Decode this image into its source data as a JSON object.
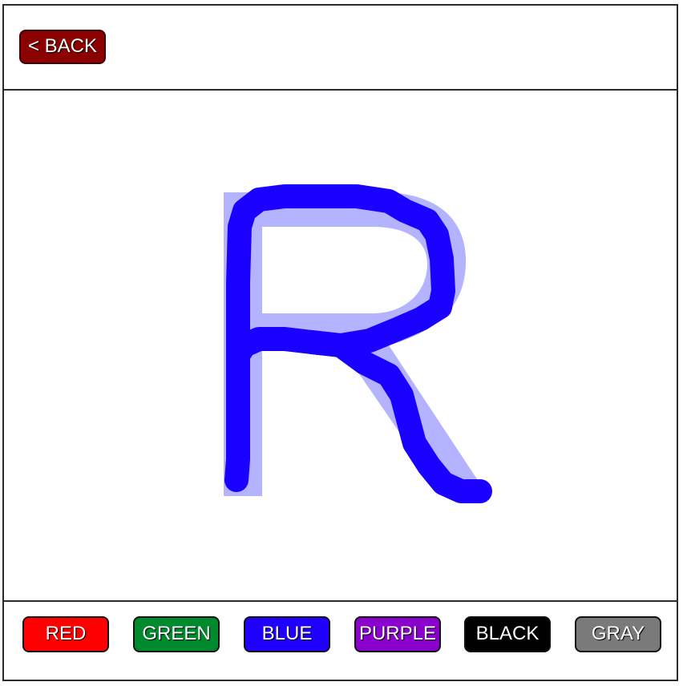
{
  "header": {
    "back_label": "< BACK",
    "back_color": "#8b0000"
  },
  "canvas": {
    "guide_icon": "letter-r-tracing-guide",
    "guide_color": "#b3b3ff",
    "stroke_color": "#1a00ff"
  },
  "footer": {
    "colors": [
      {
        "label": "RED",
        "color": "#ff0000"
      },
      {
        "label": "GREEN",
        "color": "#008a2e"
      },
      {
        "label": "BLUE",
        "color": "#1f00ff"
      },
      {
        "label": "PURPLE",
        "color": "#8a00cc"
      },
      {
        "label": "BLACK",
        "color": "#000000"
      },
      {
        "label": "GRAY",
        "color": "#7a7a7a"
      }
    ]
  }
}
